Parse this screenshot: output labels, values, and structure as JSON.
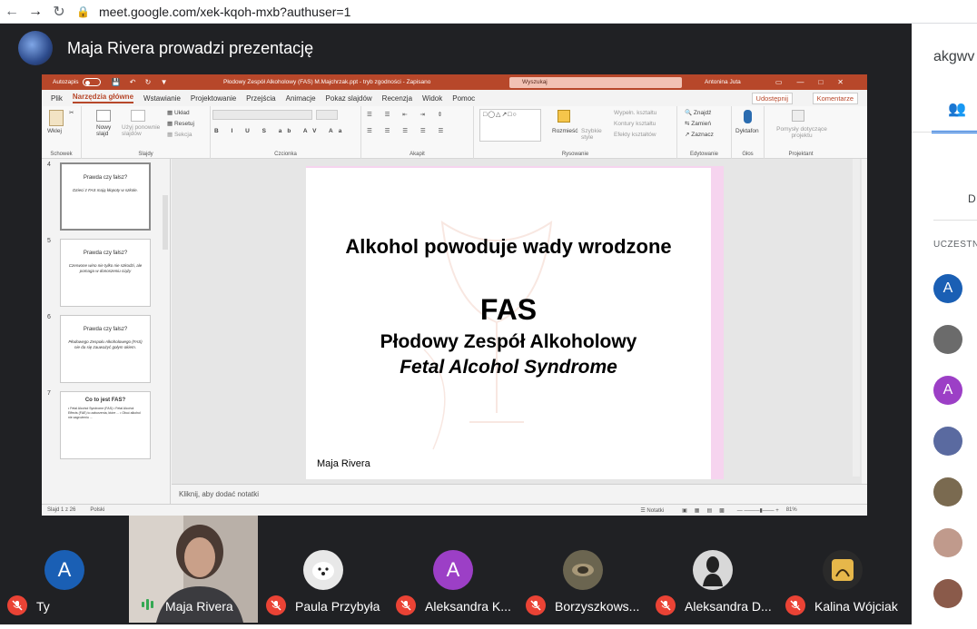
{
  "browser": {
    "url": "meet.google.com/xek-kqoh-mxb?authuser=1"
  },
  "meet": {
    "presenting_title": "Maja Rivera prowadzi prezentację"
  },
  "powerpoint": {
    "autosave_label": "Autozapis",
    "filename": "Płodowy Zespół Alkoholowy (FAS) M.Majchrzak.ppt  -  tryb zgodności  -  Zapisano",
    "search_label": "Wyszukaj",
    "user": "Antonina Juta",
    "tabs": [
      "Plik",
      "Narzędzia główne",
      "Wstawianie",
      "Projektowanie",
      "Przejścia",
      "Animacje",
      "Pokaz slajdów",
      "Recenzja",
      "Widok",
      "Pomoc"
    ],
    "share_label": "Udostępnij",
    "comments_label": "Komentarze",
    "ribbon": {
      "groups": [
        "Schowek",
        "Slajdy",
        "Czcionka",
        "Akapit",
        "Rysowanie",
        "Edytowanie",
        "Głos",
        "Projektant"
      ],
      "paste": "Wklej",
      "new_slide": "Nowy slajd",
      "reuse_slides": "Użyj ponownie slajdów",
      "layout": "Układ",
      "reset": "Resetuj",
      "section": "Sekcja",
      "arrange": "Rozmieść",
      "quick_styles": "Szybkie style",
      "shape_fill": "Wypełn. kształtu",
      "shape_outline": "Kontury kształtu",
      "shape_effects": "Efekty kształtów",
      "find": "Znajdź",
      "replace": "Zamień",
      "select": "Zaznacz",
      "dictate": "Dyktafon",
      "design_ideas": "Pomysły dotyczące projektu"
    },
    "thumbnails": [
      {
        "num": "4",
        "title": "Prawda czy fałsz?",
        "body": "Dzieci z FAS mają kłopoty w szkole."
      },
      {
        "num": "5",
        "title": "Prawda czy fałsz?",
        "body": "Czerwone wino nie tylko nie szkodzi, ale pomaga w donoszeniu ciąży"
      },
      {
        "num": "6",
        "title": "Prawda czy fałsz?",
        "body": "Płodowego Zespołu Alkoholowego (FAS) nie da się zauważyć gołym okiem."
      },
      {
        "num": "7",
        "title": "Co to jest FAS?",
        "body": "• Fetal Alcohol Syndrome (FAS) • Fetal Alcohol Effects (FAE) to zaburzenia, które ... • Obuć alkohol nie zagrożeniu ..."
      }
    ],
    "slide": {
      "heading": "Alkohol powoduje wady wrodzone",
      "acronym": "FAS",
      "polish_name": "Płodowy Zespół Alkoholowy",
      "english_name": "Fetal Alcohol Syndrome",
      "author": "Maja Rivera"
    },
    "notes_placeholder": "Kliknij, aby dodać notatki",
    "status": {
      "slide_of": "Slajd 1 z 26",
      "language": "Polski",
      "notes": "Notatki",
      "zoom": "81%"
    }
  },
  "side_panel": {
    "meeting_code": "akgwv",
    "d_label": "D",
    "section_label": "UCZESTN",
    "avatars": [
      {
        "letter": "A",
        "color": "#1a5fb4"
      },
      {
        "letter": "",
        "color": "#6b6b6b"
      },
      {
        "letter": "A",
        "color": "#9c3fc6"
      },
      {
        "letter": "",
        "color": "#5a6aa0"
      },
      {
        "letter": "",
        "color": "#7a6a50"
      },
      {
        "letter": "",
        "color": "#c09a8c"
      },
      {
        "letter": "",
        "color": "#8a5a4a"
      }
    ]
  },
  "participants": [
    {
      "name": "Ty",
      "letter": "A",
      "color": "#1a5fb4",
      "muted": true
    },
    {
      "name": "Maja Rivera",
      "letter": "",
      "color": "",
      "muted": false
    },
    {
      "name": "Paula Przybyła",
      "letter": "",
      "color": "#e8e8e8",
      "muted": true
    },
    {
      "name": "Aleksandra K...",
      "letter": "A",
      "color": "#9c3fc6",
      "muted": true
    },
    {
      "name": "Borzyszkows...",
      "letter": "",
      "color": "#6b6550",
      "muted": true
    },
    {
      "name": "Aleksandra D...",
      "letter": "",
      "color": "#d8d8d8",
      "muted": true
    },
    {
      "name": "Kalina Wójciak",
      "letter": "",
      "color": "#2a2a2a",
      "muted": true
    }
  ]
}
